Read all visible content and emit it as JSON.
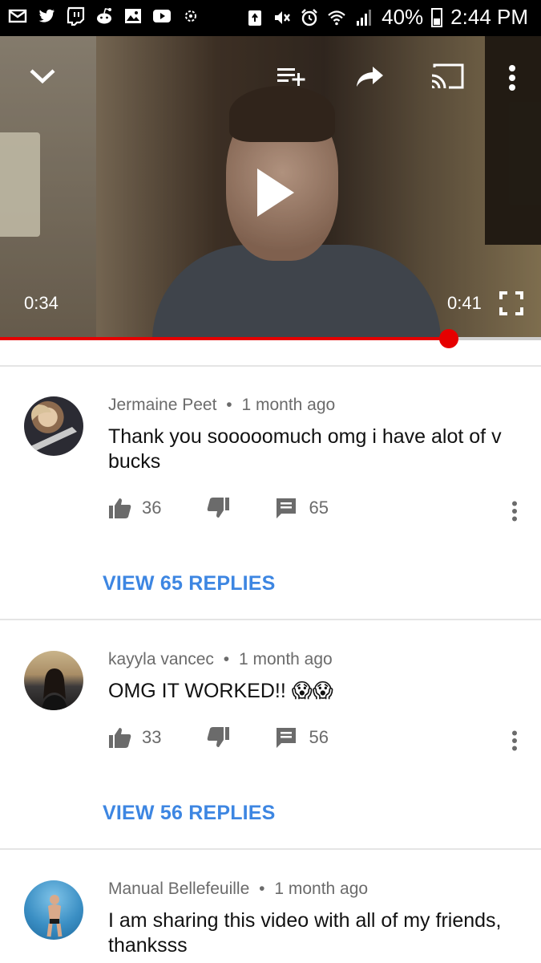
{
  "status_bar": {
    "battery": "40%",
    "time": "2:44 PM",
    "left_icons": [
      "mail-icon",
      "twitter-icon",
      "twitch-icon",
      "reddit-icon",
      "gallery-icon",
      "youtube-icon",
      "sync-icon"
    ],
    "right_icons": [
      "recycle-icon",
      "mute-icon",
      "alarm-icon",
      "wifi-icon",
      "signal-icon",
      "battery-icon"
    ]
  },
  "player": {
    "current_time": "0:34",
    "total_time": "0:41",
    "progress_fraction": 0.83,
    "accent_color": "#e60000"
  },
  "comments": [
    {
      "author": "Jermaine Peet",
      "age": "1 month ago",
      "text": "Thank you sooooomuch omg i have alot of v bucks",
      "likes": "36",
      "replies_count": "65",
      "view_replies": "VIEW 65 REPLIES"
    },
    {
      "author": "kayyla vancec",
      "age": "1 month ago",
      "text": "OMG IT WORKED!! 😱😱",
      "likes": "33",
      "replies_count": "56",
      "view_replies": "VIEW 56 REPLIES"
    },
    {
      "author": "Manual Bellefeuille",
      "age": "1 month ago",
      "text": "I am sharing this video with all of my friends, thanksss"
    }
  ],
  "separator": "•",
  "link_color": "#3d86e2"
}
